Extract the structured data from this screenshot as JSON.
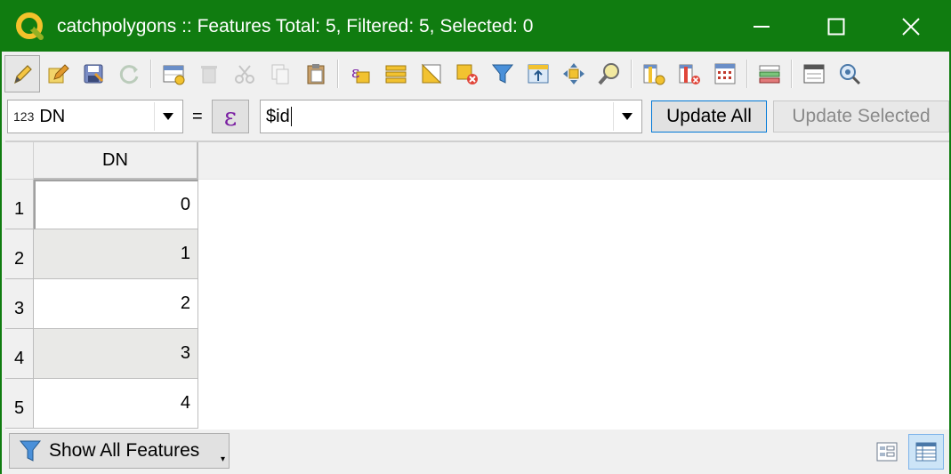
{
  "window": {
    "title": "catchpolygons :: Features Total: 5, Filtered: 5, Selected: 0"
  },
  "toolbar": {
    "icons": [
      "pencil-icon",
      "multi-edit-icon",
      "save-edits-icon",
      "reload-icon",
      "add-feature-icon",
      "delete-feature-icon",
      "cut-icon",
      "copy-icon",
      "paste-icon",
      "expression-select-icon",
      "select-all-icon",
      "invert-selection-icon",
      "deselect-icon",
      "filter-icon",
      "move-selection-top-icon",
      "pan-map-icon",
      "zoom-map-icon",
      "new-field-icon",
      "delete-field-icon",
      "field-calculator-icon",
      "conditional-format-icon",
      "dock-icon",
      "actions-icon"
    ]
  },
  "field_calculator": {
    "field_type": "123",
    "field_name": "DN",
    "equals": "=",
    "epsilon": "ε",
    "expression": "$id",
    "update_all_label": "Update All",
    "update_selected_label": "Update Selected"
  },
  "table": {
    "column_header": "DN",
    "rows": [
      {
        "num": "1",
        "dn": "0"
      },
      {
        "num": "2",
        "dn": "1"
      },
      {
        "num": "3",
        "dn": "2"
      },
      {
        "num": "4",
        "dn": "3"
      },
      {
        "num": "5",
        "dn": "4"
      }
    ]
  },
  "statusbar": {
    "show_features_label": "Show All Features",
    "dropdown_glyph": "▾"
  }
}
